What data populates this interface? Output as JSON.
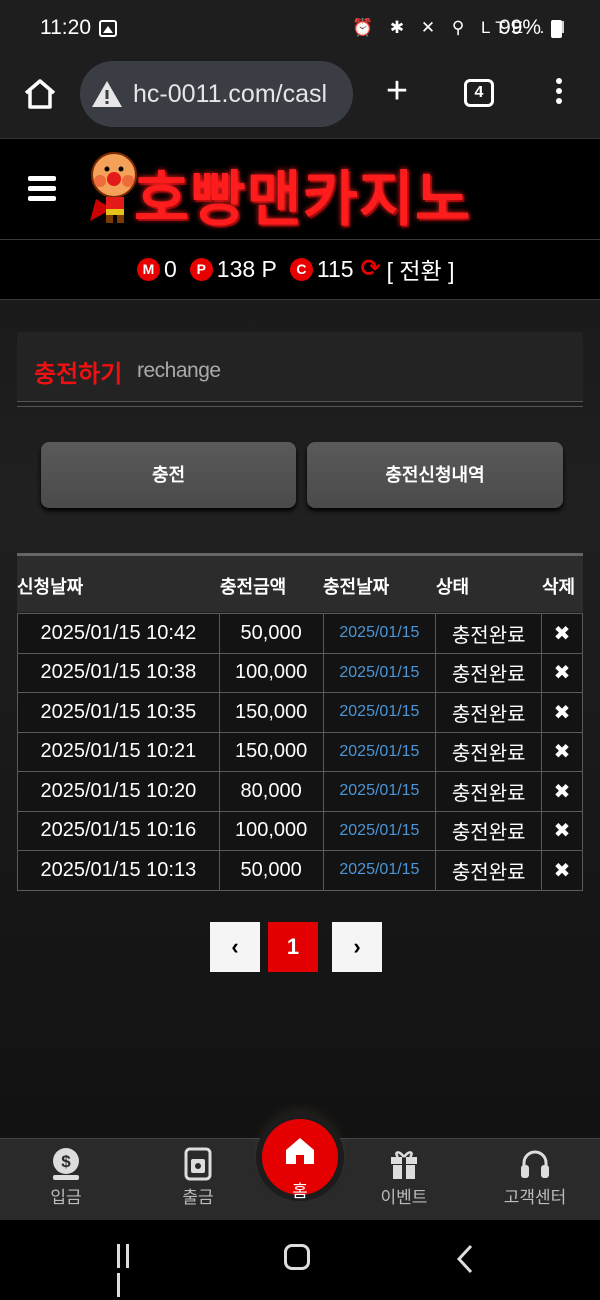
{
  "status_bar": {
    "time": "11:20",
    "right_icons": "⏰ ✱ ✕ ⚲ LTE .ıl",
    "battery": "99%"
  },
  "browser": {
    "url": "hc-0011.com/casl",
    "tab_count": "4"
  },
  "site": {
    "logo_text": "호빵맨카지노"
  },
  "balance": {
    "money_badge": "M",
    "money_value": "0",
    "point_badge": "P",
    "point_value": "138 P",
    "coupon_badge": "C",
    "coupon_value": "115",
    "convert_label": "[ 전환 ]"
  },
  "section": {
    "title": "충전하기",
    "subtitle": "rechange"
  },
  "buttons": {
    "charge": "충전",
    "history": "충전신청내역"
  },
  "table": {
    "headers": [
      "신청날짜",
      "충전금액",
      "충전날짜",
      "상태",
      "삭제"
    ],
    "rows": [
      {
        "request_date": "2025/01/15 10:42",
        "amount": "50,000",
        "charge_date": "2025/01/15",
        "status": "충전완료",
        "delete": "✖"
      },
      {
        "request_date": "2025/01/15 10:38",
        "amount": "100,000",
        "charge_date": "2025/01/15",
        "status": "충전완료",
        "delete": "✖"
      },
      {
        "request_date": "2025/01/15 10:35",
        "amount": "150,000",
        "charge_date": "2025/01/15",
        "status": "충전완료",
        "delete": "✖"
      },
      {
        "request_date": "2025/01/15 10:21",
        "amount": "150,000",
        "charge_date": "2025/01/15",
        "status": "충전완료",
        "delete": "✖"
      },
      {
        "request_date": "2025/01/15 10:20",
        "amount": "80,000",
        "charge_date": "2025/01/15",
        "status": "충전완료",
        "delete": "✖"
      },
      {
        "request_date": "2025/01/15 10:16",
        "amount": "100,000",
        "charge_date": "2025/01/15",
        "status": "충전완료",
        "delete": "✖"
      },
      {
        "request_date": "2025/01/15 10:13",
        "amount": "50,000",
        "charge_date": "2025/01/15",
        "status": "충전완료",
        "delete": "✖"
      }
    ]
  },
  "pagination": {
    "prev": "‹",
    "current": "1",
    "next": "›"
  },
  "bottom_nav": {
    "deposit": "입금",
    "withdraw": "출금",
    "home": "홈",
    "event": "이벤트",
    "support": "고객센터"
  },
  "colors": {
    "accent": "#e40000",
    "link": "#4a96d8",
    "background": "#141414"
  },
  "icons": [
    "home-icon",
    "warning-icon",
    "plus-icon",
    "tabs-icon",
    "more-icon",
    "hamburger-icon",
    "refresh-icon",
    "dollar-icon",
    "wallet-icon",
    "gift-icon",
    "headset-icon"
  ]
}
